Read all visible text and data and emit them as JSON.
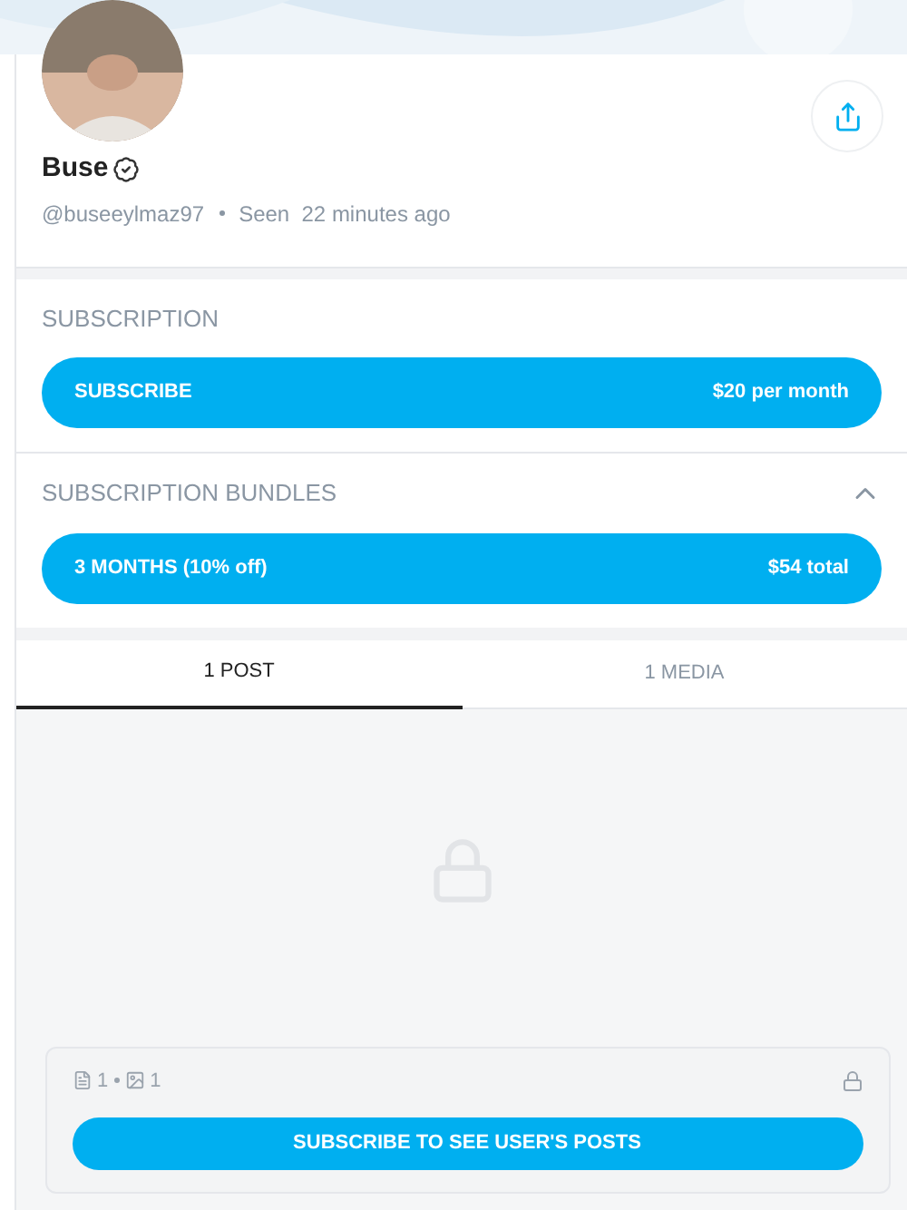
{
  "profile": {
    "name": "Buse",
    "verified": true,
    "handle": "@buseeylmaz97",
    "seen": "Seen  22 minutes ago"
  },
  "subscription": {
    "heading": "SUBSCRIPTION",
    "button": {
      "label": "SUBSCRIBE",
      "price": "$20 per month"
    }
  },
  "bundles": {
    "heading": "SUBSCRIPTION BUNDLES",
    "expanded": true,
    "items": [
      {
        "label": "3 MONTHS (10% off)",
        "price": "$54 total"
      }
    ]
  },
  "tabs": [
    {
      "label": "1 POST",
      "selected": true
    },
    {
      "label": "1 MEDIA",
      "selected": false
    }
  ],
  "locked_post": {
    "post_count": "1",
    "media_count": "1",
    "button": "SUBSCRIBE TO SEE USER'S POSTS"
  }
}
